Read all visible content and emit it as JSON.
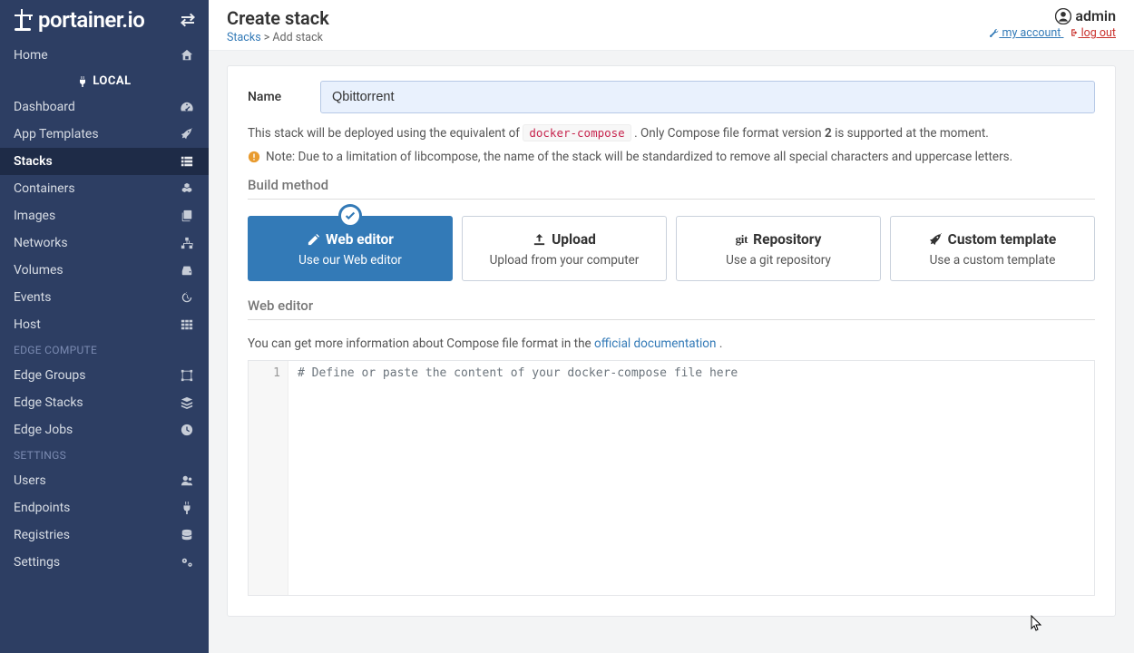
{
  "logo": "portainer.io",
  "header": {
    "title": "Create stack",
    "crumb_link": "Stacks",
    "crumb_sep": ">",
    "crumb_current": "Add stack",
    "user": "admin",
    "account_link": "my account",
    "logout_link": "log out"
  },
  "sidebar": {
    "home": "Home",
    "local_label": "LOCAL",
    "items_local": [
      {
        "label": "Dashboard"
      },
      {
        "label": "App Templates"
      },
      {
        "label": "Stacks"
      },
      {
        "label": "Containers"
      },
      {
        "label": "Images"
      },
      {
        "label": "Networks"
      },
      {
        "label": "Volumes"
      },
      {
        "label": "Events"
      },
      {
        "label": "Host"
      }
    ],
    "heading_edge": "EDGE COMPUTE",
    "items_edge": [
      {
        "label": "Edge Groups"
      },
      {
        "label": "Edge Stacks"
      },
      {
        "label": "Edge Jobs"
      }
    ],
    "heading_settings": "SETTINGS",
    "items_settings": [
      {
        "label": "Users"
      },
      {
        "label": "Endpoints"
      },
      {
        "label": "Registries"
      },
      {
        "label": "Settings"
      }
    ]
  },
  "form": {
    "name_label": "Name",
    "name_value": "Qbittorrent",
    "helper_pre": "This stack will be deployed using the equivalent of ",
    "helper_code": "docker-compose",
    "helper_mid": " . Only Compose file format version ",
    "helper_ver": "2",
    "helper_post": " is supported at the moment.",
    "note": "Note: Due to a limitation of libcompose, the name of the stack will be standardized to remove all special characters and uppercase letters."
  },
  "build": {
    "heading": "Build method",
    "methods": [
      {
        "title": "Web editor",
        "sub": "Use our Web editor"
      },
      {
        "title": "Upload",
        "sub": "Upload from your computer"
      },
      {
        "title": "Repository",
        "sub": "Use a git repository"
      },
      {
        "title": "Custom template",
        "sub": "Use a custom template"
      }
    ]
  },
  "editor": {
    "heading": "Web editor",
    "info_pre": "You can get more information about Compose file format in the ",
    "info_link": "official documentation",
    "info_post": ".",
    "line_no": "1",
    "placeholder": "# Define or paste the content of your docker-compose file here"
  }
}
